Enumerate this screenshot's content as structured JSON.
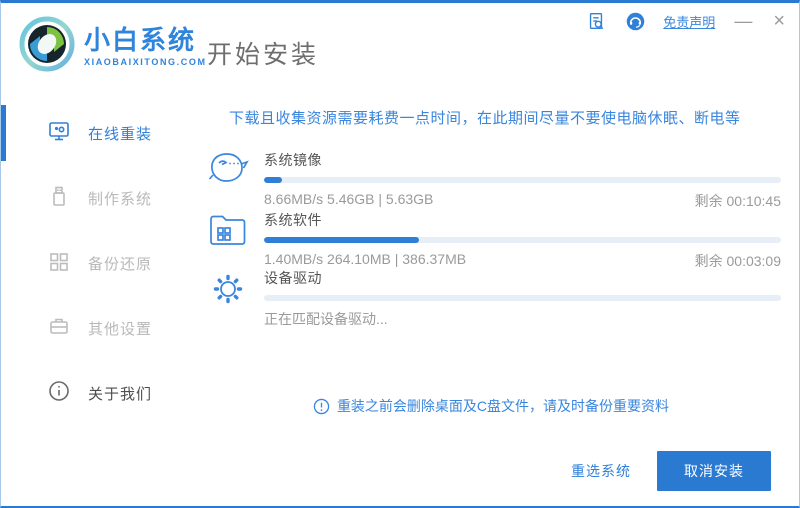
{
  "titlebar": {
    "disclaimer": "免责声明",
    "minimize": "—",
    "close": "×"
  },
  "brand": {
    "name": "小白系统",
    "domain": "XIAOBAIXITONG.COM"
  },
  "header": {
    "page_title": "开始安装"
  },
  "sidebar": {
    "items": [
      {
        "label": "在线重装",
        "active": true
      },
      {
        "label": "制作系统",
        "active": false
      },
      {
        "label": "备份还原",
        "active": false
      },
      {
        "label": "其他设置",
        "active": false
      },
      {
        "label": "关于我们",
        "active": false
      }
    ]
  },
  "main": {
    "notice": "下载且收集资源需要耗费一点时间，在此期间尽量不要使电脑休眠、断电等",
    "tasks": [
      {
        "name": "系统镜像",
        "detail": "8.66MB/s 5.46GB | 5.63GB",
        "remaining": "剩余 00:10:45",
        "progress_percent": 3.5
      },
      {
        "name": "系统软件",
        "detail": "1.40MB/s 264.10MB | 386.37MB",
        "remaining": "剩余 00:03:09",
        "progress_percent": 30
      },
      {
        "name": "设备驱动",
        "detail": "正在匹配设备驱动...",
        "remaining": "",
        "progress_percent": 0
      }
    ],
    "warning": "重装之前会删除桌面及C盘文件，请及时备份重要资料"
  },
  "footer": {
    "reselect": "重选系统",
    "cancel": "取消安装"
  },
  "colors": {
    "accent": "#2b7ad2",
    "accent_text": "#3a86dd",
    "inactive_gray": "#b9b9b9",
    "progress_track": "#e8eef8"
  }
}
